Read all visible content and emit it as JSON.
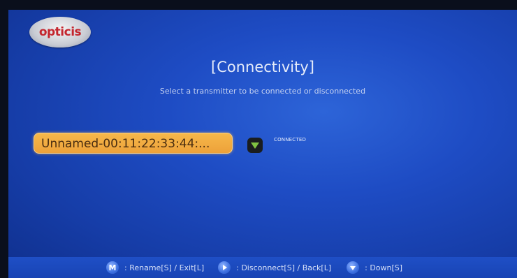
{
  "logo": {
    "text": "opticis"
  },
  "title": "[Connectivity]",
  "subtitle": "Select a transmitter to be connected or disconnected",
  "transmitters": [
    {
      "name": "Unnamed-00:11:22:33:44:...",
      "status": "CONNECTED",
      "status_icon": "wifi-icon"
    }
  ],
  "footer": {
    "hints": [
      {
        "key": "M",
        "icon": "m-key-icon",
        "label": ": Rename[S] / Exit[L]"
      },
      {
        "key": "",
        "icon": "play-right-icon",
        "label": ": Disconnect[S] / Back[L]"
      },
      {
        "key": "",
        "icon": "down-arrow-icon",
        "label": ": Down[S]"
      }
    ]
  },
  "colors": {
    "accent": "#eda13a",
    "background": "#1e4cc4",
    "status_icon": "#7fc242"
  }
}
